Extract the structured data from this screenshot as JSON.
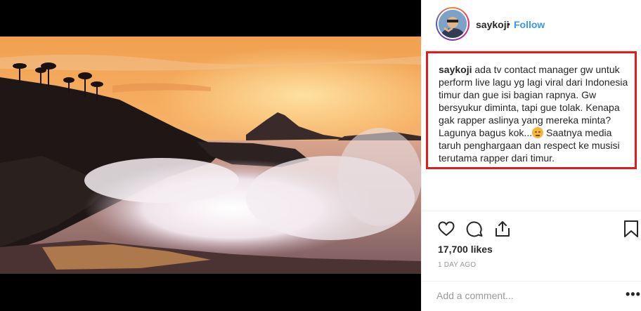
{
  "header": {
    "username": "saykoji",
    "separator": "•",
    "follow_label": "Follow"
  },
  "caption": {
    "username": "saykoji",
    "text_part1": "ada tv contact manager gw untuk perform live lagu yg lagi viral dari Indonesia timur dan gue isi bagian rapnya. Gw bersyukur diminta, tapi gue tolak. Kenapa gak rapper aslinya yang mereka minta? Lagunya bagus kok...",
    "text_part2": " Saatnya media taruh penghargaan dan respect ke musisi terutama rapper dari timur.",
    "emoji": "pensive-face-emoji",
    "highlight_color": "#e21b1b"
  },
  "actions": {
    "like_icon": "heart-icon",
    "comment_icon": "comment-bubble-icon",
    "share_icon": "share-icon",
    "save_icon": "bookmark-icon"
  },
  "likes": "17,700 likes",
  "time_ago": "1 DAY AGO",
  "comment_bar": {
    "placeholder": "Add a comment...",
    "more_label": "•••"
  },
  "colors": {
    "accent": "#3897f0",
    "text": "#262626",
    "muted": "#999999"
  }
}
